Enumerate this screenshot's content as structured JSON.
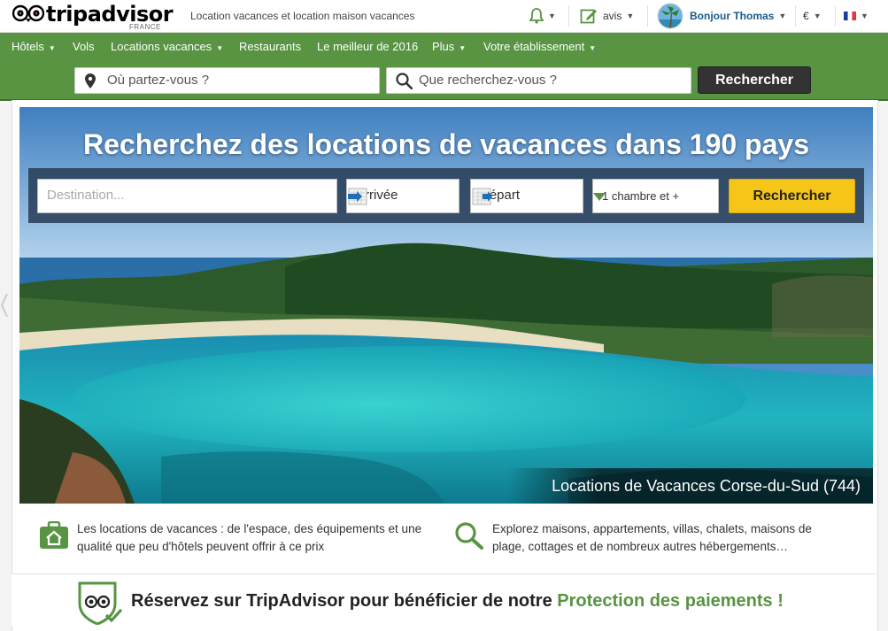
{
  "header": {
    "logo_text": "tripadvisor",
    "logo_sub": "FRANCE",
    "tagline": "Location vacances et location maison vacances",
    "reviews_label": "avis",
    "user_greeting": "Bonjour Thomas",
    "currency": "€"
  },
  "nav": {
    "items": [
      {
        "label": "Hôtels",
        "dropdown": true
      },
      {
        "label": "Vols",
        "dropdown": false
      },
      {
        "label": "Locations vacances",
        "dropdown": true
      },
      {
        "label": "Restaurants",
        "dropdown": false
      },
      {
        "label": "Le meilleur de 2016",
        "dropdown": false
      },
      {
        "label": "Plus",
        "dropdown": true
      },
      {
        "label": "Votre établissement",
        "dropdown": true
      }
    ]
  },
  "search": {
    "where_placeholder": "Où partez-vous ?",
    "what_placeholder": "Que recherchez-vous ?",
    "button": "Rechercher"
  },
  "hero": {
    "title": "Recherchez des locations de vacances dans 190 pays",
    "destination_placeholder": "Destination...",
    "checkin_label": "Arrivée",
    "checkout_label": "Départ",
    "rooms_value": "1 chambre et +",
    "button": "Rechercher",
    "caption": "Locations de Vacances Corse-du-Sud (744)"
  },
  "features": {
    "left_text": "Les locations de vacances : de l'espace, des équipements et une qualité que peu d'hôtels peuvent offrir à ce prix",
    "right_text": "Explorez maisons, appartements, villas, chalets, maisons de plage, cottages et de nombreux autres hébergements…"
  },
  "trust": {
    "text_prefix": "Réservez sur TripAdvisor pour bénéficier de notre",
    "text_highlight": "Protection des paiements !"
  },
  "colors": {
    "brand_green": "#589442",
    "search_button": "#333333",
    "hero_button": "#f5c518"
  }
}
